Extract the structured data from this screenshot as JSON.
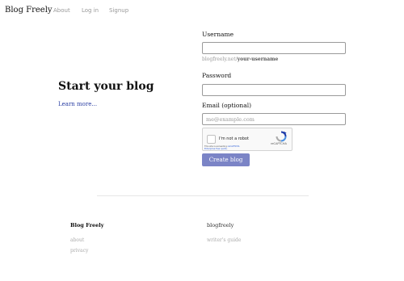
{
  "nav": {
    "brand": "Blog Freely",
    "links": [
      "About",
      "Log in",
      "Signup"
    ]
  },
  "hero": {
    "title": "Start your blog",
    "learn_more": "Learn more..."
  },
  "form": {
    "username_label": "Username",
    "username_value": "",
    "username_hint_prefix": "blogfreely.net/",
    "username_hint_suffix": "your-username",
    "password_label": "Password",
    "password_value": "",
    "email_label": "Email (optional)",
    "email_placeholder": "me@example.com",
    "submit_label": "Create blog"
  },
  "captcha": {
    "label": "I'm not a robot",
    "brand": "reCAPTCHA",
    "fine_print_1_prefix": "This site is exceeding ",
    "fine_print_1_link": "reCAPTCHA",
    "fine_print_2": "Enterprise free quota.",
    "logo_icon": "recaptcha-logo-icon"
  },
  "footer": {
    "col1_title": "Blog Freely",
    "col1_links": [
      "about",
      "privacy"
    ],
    "col2_title": "blogfreely",
    "col2_links": [
      "writer's guide"
    ]
  },
  "colors": {
    "accent_button": "#7b84c6",
    "link": "#2a3ea3",
    "muted": "#999999"
  }
}
